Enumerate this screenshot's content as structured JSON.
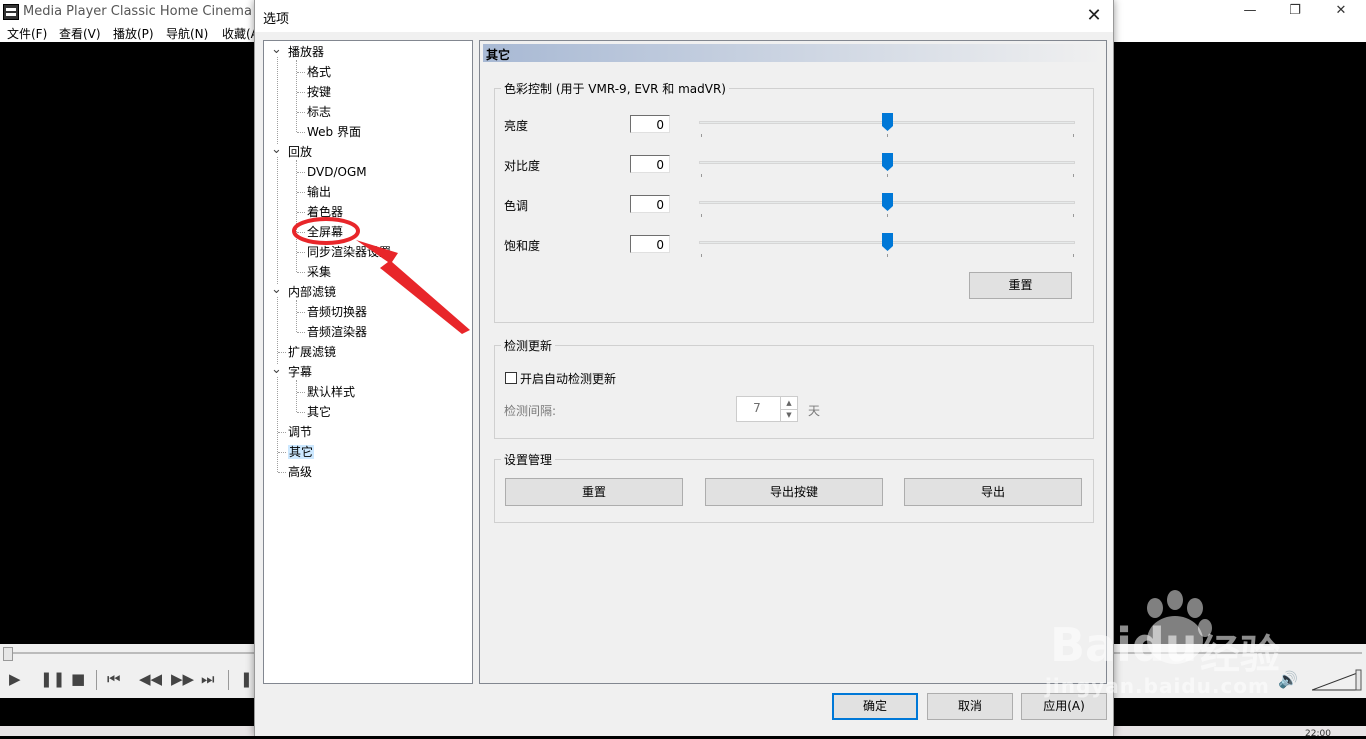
{
  "app": {
    "title": "Media Player Classic Home Cinema",
    "menu": [
      "文件(F)",
      "查看(V)",
      "播放(P)",
      "导航(N)",
      "收藏(A"
    ],
    "window_buttons": {
      "minimize": "—",
      "restore": "❐",
      "close": "✕"
    },
    "clock": "22:00"
  },
  "dialog": {
    "title": "选项",
    "close": "✕",
    "tree": [
      {
        "label": "播放器",
        "level": 0,
        "expanded": true
      },
      {
        "label": "格式",
        "level": 1
      },
      {
        "label": "按键",
        "level": 1
      },
      {
        "label": "标志",
        "level": 1
      },
      {
        "label": "Web 界面",
        "level": 1
      },
      {
        "label": "回放",
        "level": 0,
        "expanded": true
      },
      {
        "label": "DVD/OGM",
        "level": 1
      },
      {
        "label": "输出",
        "level": 1
      },
      {
        "label": "着色器",
        "level": 1
      },
      {
        "label": "全屏幕",
        "level": 1
      },
      {
        "label": "同步渲染器设置",
        "level": 1
      },
      {
        "label": "采集",
        "level": 1
      },
      {
        "label": "内部滤镜",
        "level": 0,
        "expanded": true
      },
      {
        "label": "音频切换器",
        "level": 1
      },
      {
        "label": "音频渲染器",
        "level": 1
      },
      {
        "label": "扩展滤镜",
        "level": 0
      },
      {
        "label": "字幕",
        "level": 0,
        "expanded": true
      },
      {
        "label": "默认样式",
        "level": 1
      },
      {
        "label": "其它",
        "level": 1
      },
      {
        "label": "调节",
        "level": 0
      },
      {
        "label": "其它",
        "level": 0,
        "selected": true
      },
      {
        "label": "高级",
        "level": 0
      }
    ],
    "page_title": "其它",
    "color_group": {
      "title": "色彩控制 (用于 VMR-9, EVR 和 madVR)",
      "rows": [
        {
          "label": "亮度",
          "value": "0",
          "position": 0.5
        },
        {
          "label": "对比度",
          "value": "0",
          "position": 0.5
        },
        {
          "label": "色调",
          "value": "0",
          "position": 0.5
        },
        {
          "label": "饱和度",
          "value": "0",
          "position": 0.5
        }
      ],
      "reset_label": "重置"
    },
    "update_group": {
      "title": "检测更新",
      "checkbox_label": "开启自动检测更新",
      "checked": false,
      "interval_label": "检测间隔:",
      "interval_value": "7",
      "interval_unit": "天"
    },
    "settings_group": {
      "title": "设置管理",
      "reset_label": "重置",
      "export_keys_label": "导出按键",
      "export_label": "导出"
    },
    "buttons": {
      "ok": "确定",
      "cancel": "取消",
      "apply": "应用(A)"
    }
  },
  "watermark": {
    "brand": "Baidu",
    "cn": "经验",
    "url": "jingyan.baidu.com"
  },
  "colors": {
    "accent": "#0078d7",
    "annotation": "#e8262a",
    "selection": "#cce8ff"
  }
}
